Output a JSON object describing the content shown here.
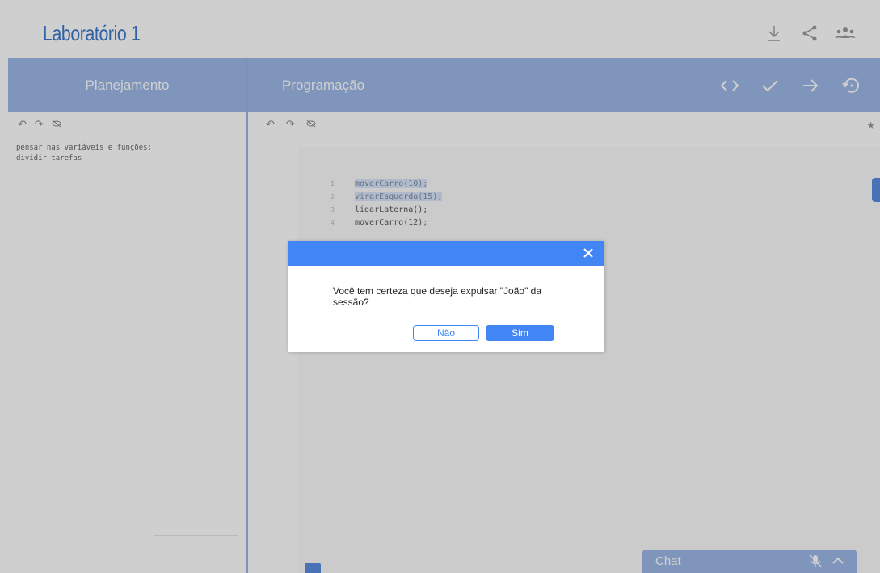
{
  "header": {
    "title": "Laboratório 1",
    "icons": [
      "download-icon",
      "share-icon",
      "users-icon"
    ]
  },
  "planning": {
    "title": "Planejamento",
    "toolbar_icons": [
      "undo-icon",
      "redo-icon",
      "visibility-off-icon"
    ],
    "notes": [
      "pensar nas variáveis e funções;",
      "dividir tarefas"
    ]
  },
  "programming": {
    "title": "Programação",
    "header_icons": [
      "code-icon",
      "check-icon",
      "arrow-right-icon",
      "history-icon"
    ],
    "toolbar_icons": [
      "undo-icon",
      "redo-icon",
      "visibility-off-icon"
    ],
    "code_lines": [
      {
        "num": "1",
        "text": "moverCarro(10);"
      },
      {
        "num": "2",
        "text": "virarEsquerda(15);"
      },
      {
        "num": "3",
        "text": "ligarLaterna();"
      },
      {
        "num": "4",
        "text": "moverCarro(12);"
      }
    ]
  },
  "chat": {
    "label": "Chat"
  },
  "dialog": {
    "message": "Você tem certeza que deseja expulsar \"João\" da sessão?",
    "no_label": "Não",
    "yes_label": "Sim"
  },
  "colors": {
    "accent": "#4285f4",
    "panel_header": "#9eb8e8",
    "title": "#3b78c9"
  }
}
